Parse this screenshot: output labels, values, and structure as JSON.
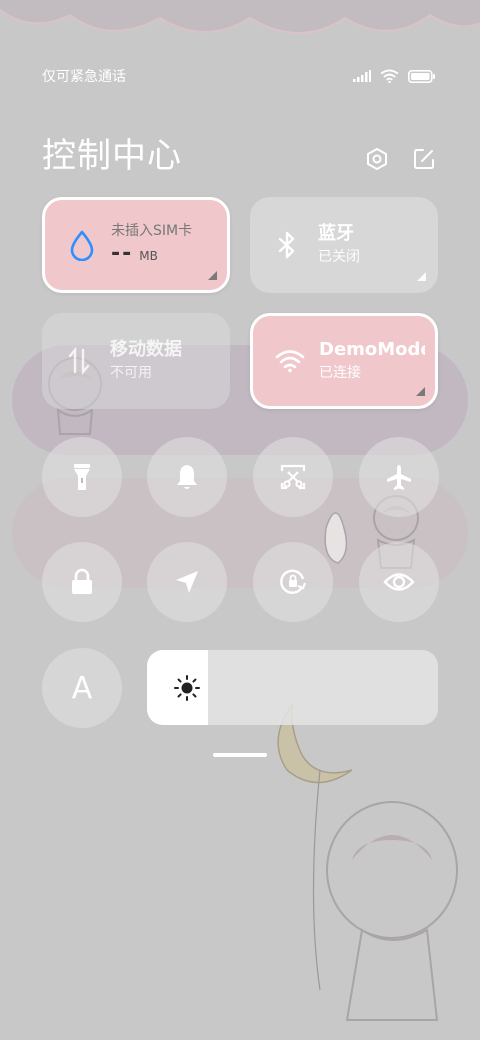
{
  "status_bar": {
    "carrier_text": "仅可紧急通话"
  },
  "header": {
    "title": "控制中心"
  },
  "tiles": {
    "data": {
      "title": "未插入SIM卡",
      "value": "--",
      "unit": "MB"
    },
    "bluetooth": {
      "title": "蓝牙",
      "status": "已关闭"
    },
    "mobile": {
      "title": "移动数据",
      "status": "不可用"
    },
    "wifi": {
      "title": "DemoMode",
      "status": "已连接"
    }
  },
  "toggles": [
    {
      "icon": "flashlight-icon"
    },
    {
      "icon": "bell-icon"
    },
    {
      "icon": "screenshot-icon"
    },
    {
      "icon": "airplane-icon"
    },
    {
      "icon": "lock-icon"
    },
    {
      "icon": "location-icon"
    },
    {
      "icon": "rotation-lock-icon"
    },
    {
      "icon": "eye-icon"
    }
  ],
  "auto_brightness": {
    "label": "A"
  },
  "brightness": {
    "level": 0.21
  },
  "colors": {
    "accent_tile": "#f0c8cc",
    "background": "#c9c8c9",
    "drop_icon": "#2f8fff"
  }
}
